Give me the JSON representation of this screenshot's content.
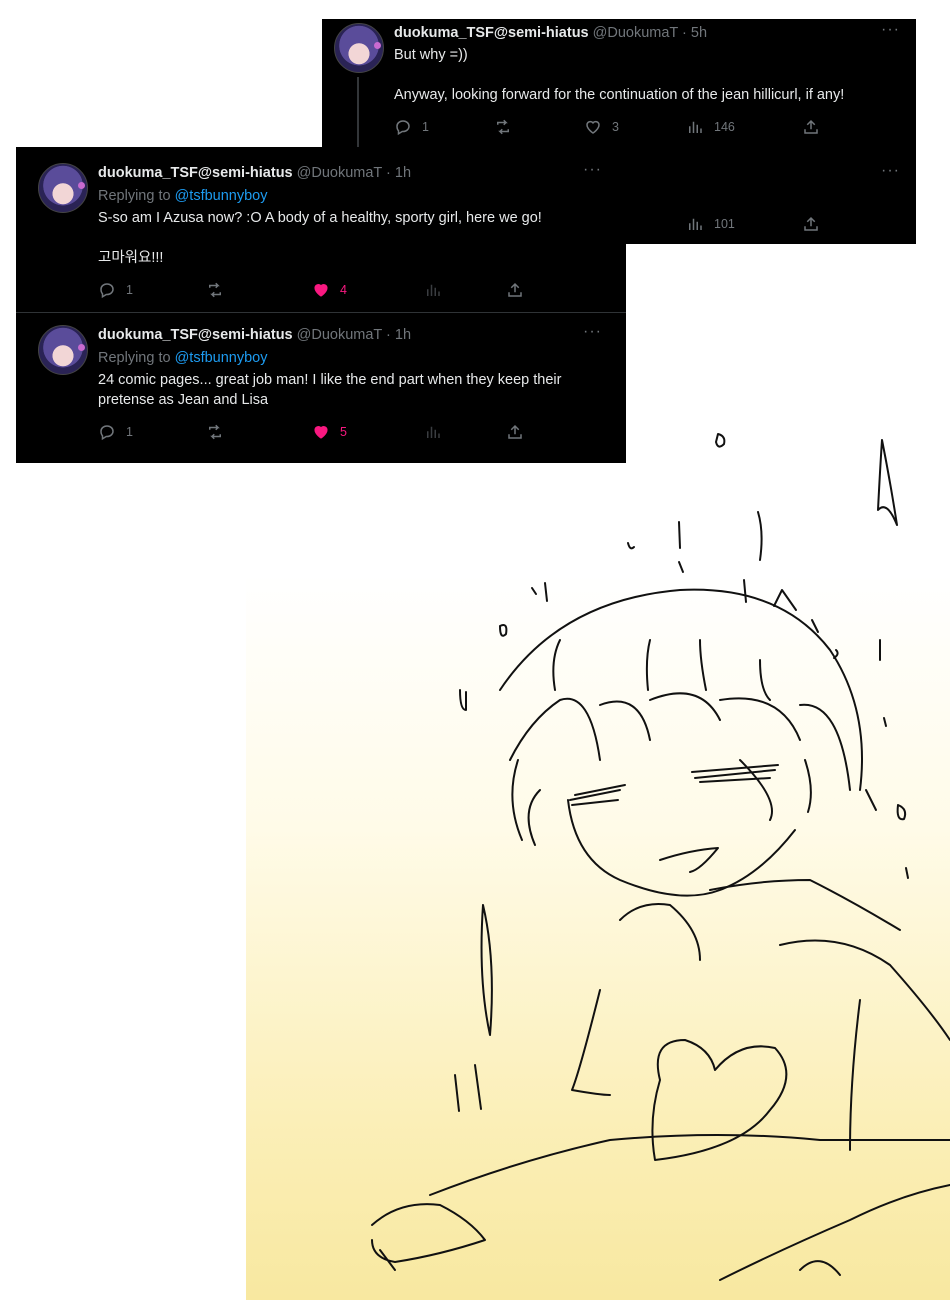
{
  "tweets": [
    {
      "name": "duokuma_TSF@semi-hiatus",
      "handle": "@DuokumaT · 5h",
      "body_line1": "But why =))",
      "body_line2": "Anyway, looking forward for the continuation of the jean hillicurl, if any!",
      "replies": "1",
      "likes": "3",
      "views": "146"
    },
    {
      "views": "101"
    },
    {
      "name": "duokuma_TSF@semi-hiatus",
      "handle": "@DuokumaT · 1h",
      "replying_label": "Replying to",
      "replying_to": "@tsfbunnyboy",
      "body_line1": "S-so am I Azusa now? :O A body of a healthy, sporty girl, here we go!",
      "body_line2": "고마워요!!!",
      "replies": "1",
      "likes": "4"
    },
    {
      "name": "duokuma_TSF@semi-hiatus",
      "handle": "@DuokumaT · 1h",
      "replying_label": "Replying to",
      "replying_to": "@tsfbunnyboy",
      "body_line1": "24 comic pages... great job man! I like the end part when they keep their",
      "body_line2": "pretense as Jean and Lisa",
      "replies": "1",
      "likes": "5"
    }
  ],
  "icons": {
    "more": "more-options-icon",
    "reply": "reply-icon",
    "retweet": "retweet-icon",
    "like": "heart-icon",
    "views": "views-icon",
    "share": "share-icon"
  },
  "colors": {
    "card_bg": "#000000",
    "text": "#e7e9ea",
    "muted": "#71767b",
    "link": "#1d9bf0",
    "like": "#f91880",
    "gradient_bottom": "#f8e8a0"
  }
}
